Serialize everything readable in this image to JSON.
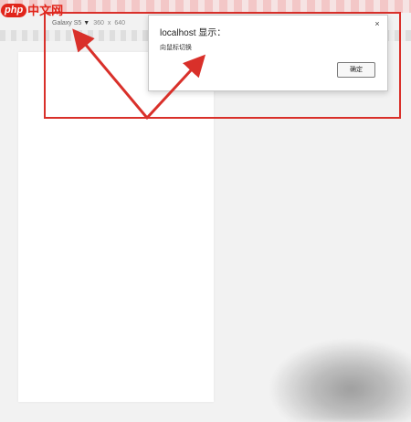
{
  "watermark": {
    "logo_php": "php",
    "logo_cn": "中文网"
  },
  "device_toolbar": {
    "device_name": "Galaxy S5",
    "width": "360",
    "times": "x",
    "height": "640"
  },
  "dialog": {
    "title": "localhost 显示：",
    "message": "向鼠标切换",
    "ok_label": "确定",
    "close_label": "×"
  },
  "colors": {
    "highlight": "#d9302a",
    "arrow": "#d9302a",
    "logo_red": "#e1251b"
  }
}
